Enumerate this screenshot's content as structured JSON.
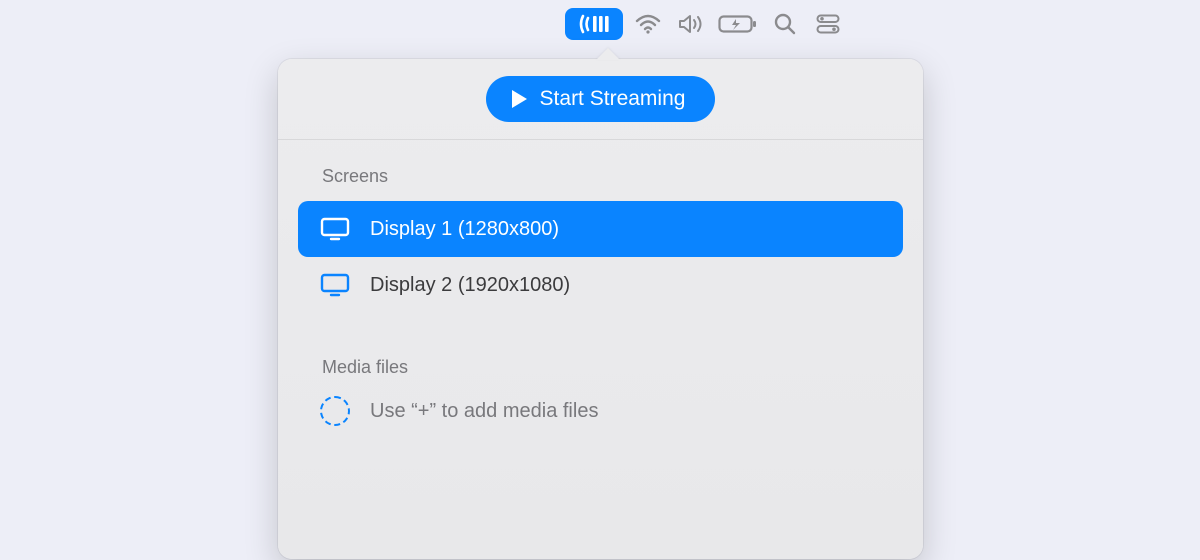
{
  "menubar": {
    "icons": {
      "streaming": "streaming-icon",
      "wifi": "wifi-icon",
      "volume": "volume-icon",
      "battery": "battery-icon",
      "search": "search-icon",
      "control": "control-center-icon"
    }
  },
  "popover": {
    "start_button_label": "Start Streaming",
    "screens_section_label": "Screens",
    "screens": [
      {
        "label": "Display 1 (1280x800)",
        "selected": true
      },
      {
        "label": "Display 2 (1920x1080)",
        "selected": false
      }
    ],
    "media_section_label": "Media files",
    "media_placeholder": "Use “+” to add media files"
  },
  "colors": {
    "accent": "#0a84ff",
    "background": "#edeef7",
    "panel": "#ececee",
    "muted": "#78787c"
  }
}
